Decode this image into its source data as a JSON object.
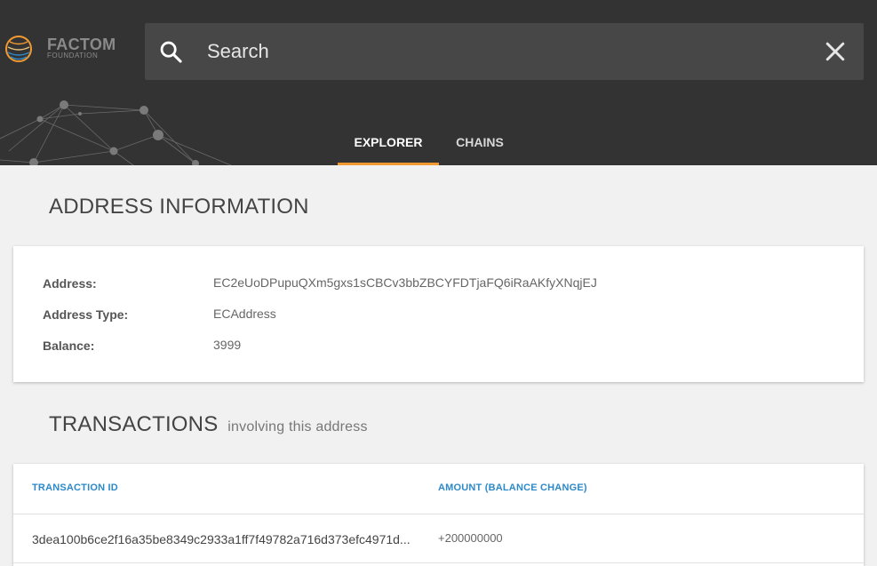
{
  "brand": {
    "name": "FACTOM",
    "subtitle": "FOUNDATION",
    "accent": "#f19a32"
  },
  "search": {
    "placeholder": "Search",
    "value": ""
  },
  "tabs": [
    {
      "label": "EXPLORER",
      "active": true
    },
    {
      "label": "CHAINS",
      "active": false
    }
  ],
  "address_section": {
    "title": "ADDRESS INFORMATION",
    "fields": [
      {
        "label": "Address:",
        "value": "EC2eUoDPupuQXm5gxs1sCBCv3bbZBCYFDTjaFQ6iRaAKfyXNqjEJ"
      },
      {
        "label": "Address Type:",
        "value": "ECAddress"
      },
      {
        "label": "Balance:",
        "value": "3999"
      }
    ]
  },
  "transactions": {
    "title": "TRANSACTIONS",
    "subtitle": "involving this address",
    "columns": [
      "TRANSACTION ID",
      "AMOUNT (BALANCE CHANGE)"
    ],
    "rows": [
      {
        "id": "3dea100b6ce2f16a35be8349c2933a1ff7f49782a716d373efc4971d...",
        "amount": "+200000000"
      }
    ]
  },
  "icons": {
    "search": "search-icon",
    "clear": "close-icon",
    "logo": "factom-logo-icon"
  }
}
